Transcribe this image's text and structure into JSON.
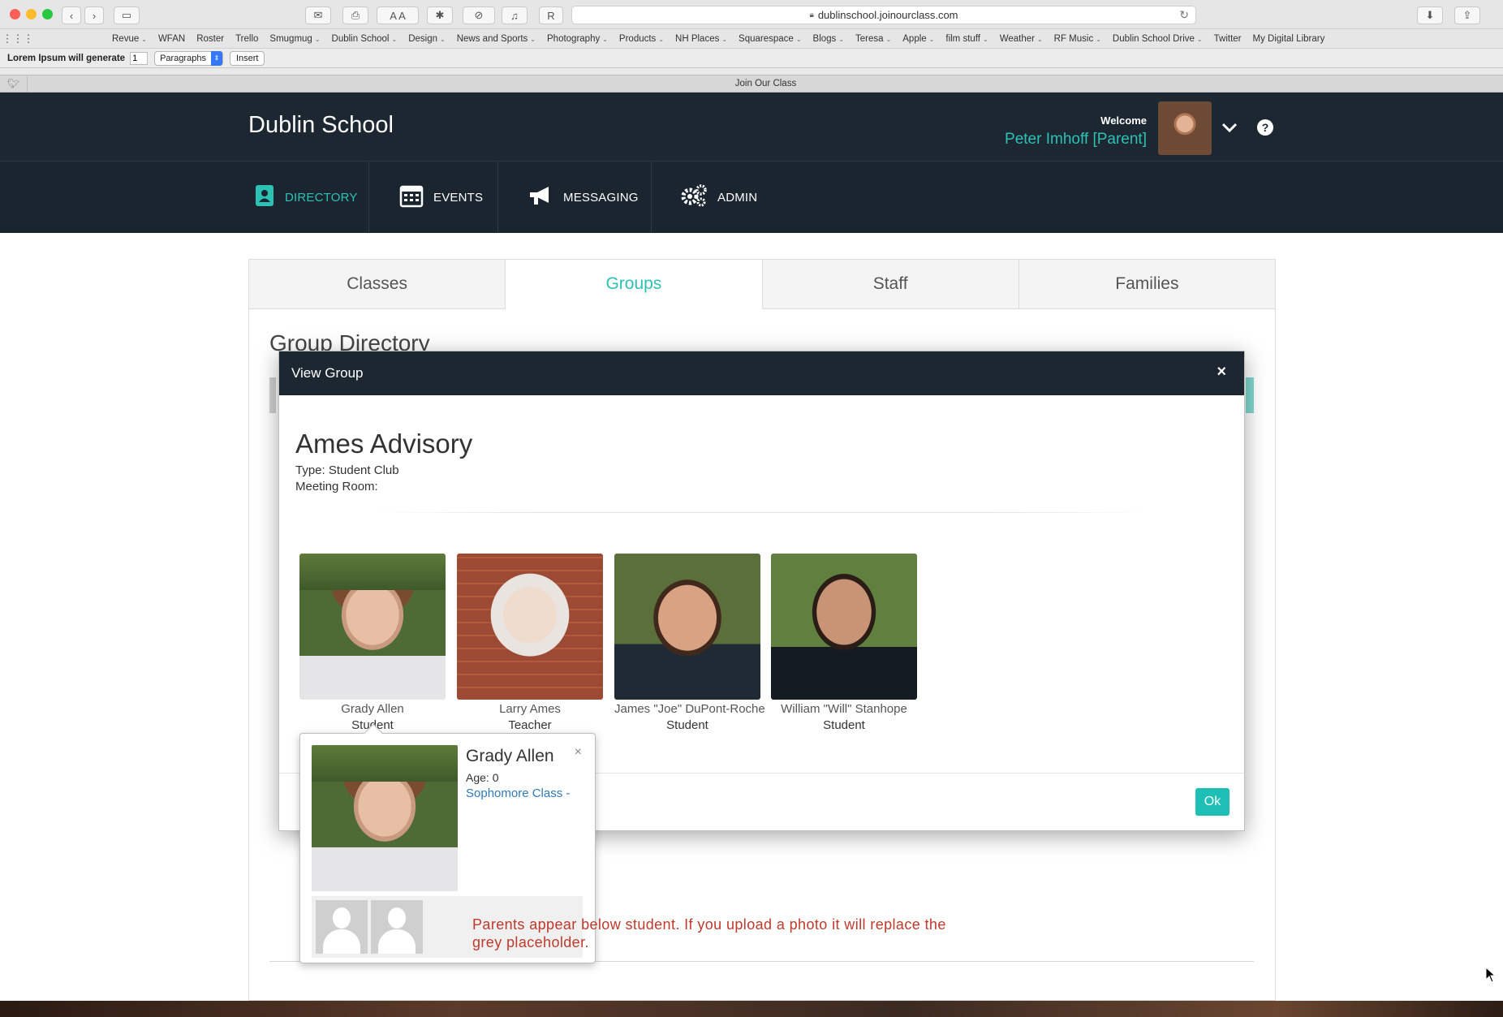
{
  "browser": {
    "url": "dublinschool.joinourclass.com",
    "tab_title": "Join Our Class",
    "bookmarks": [
      {
        "label": "Revue",
        "dropdown": true
      },
      {
        "label": "WFAN",
        "dropdown": false
      },
      {
        "label": "Roster",
        "dropdown": false
      },
      {
        "label": "Trello",
        "dropdown": false
      },
      {
        "label": "Smugmug",
        "dropdown": true
      },
      {
        "label": "Dublin School",
        "dropdown": true
      },
      {
        "label": "Design",
        "dropdown": true
      },
      {
        "label": "News and Sports",
        "dropdown": true
      },
      {
        "label": "Photography",
        "dropdown": true
      },
      {
        "label": "Products",
        "dropdown": true
      },
      {
        "label": "NH Places",
        "dropdown": true
      },
      {
        "label": "Squarespace",
        "dropdown": true
      },
      {
        "label": "Blogs",
        "dropdown": true
      },
      {
        "label": "Teresa",
        "dropdown": true
      },
      {
        "label": "Apple",
        "dropdown": true
      },
      {
        "label": "film stuff",
        "dropdown": true
      },
      {
        "label": "Weather",
        "dropdown": true
      },
      {
        "label": "RF Music",
        "dropdown": true
      },
      {
        "label": "Dublin School Drive",
        "dropdown": true
      },
      {
        "label": "Twitter",
        "dropdown": false
      },
      {
        "label": "My Digital Library",
        "dropdown": false
      }
    ]
  },
  "lorem_bar": {
    "label": "Lorem Ipsum will generate",
    "count": "1",
    "type": "Paragraphs",
    "insert": "Insert"
  },
  "header": {
    "brand": "Dublin School",
    "welcome": "Welcome",
    "user": "Peter Imhoff [Parent]"
  },
  "nav": {
    "directory": "DIRECTORY",
    "events": "EVENTS",
    "messaging": "MESSAGING",
    "admin": "ADMIN"
  },
  "dir_tabs": {
    "classes": "Classes",
    "groups": "Groups",
    "staff": "Staff",
    "families": "Families"
  },
  "page": {
    "title": "Group Directory"
  },
  "modal": {
    "title": "View Group",
    "close": "×",
    "group_name": "Ames Advisory",
    "type_line": "Type: Student Club",
    "room_line": "Meeting Room:",
    "members": [
      {
        "name": "Grady Allen",
        "role": "Student"
      },
      {
        "name": "Larry Ames",
        "role": "Teacher"
      },
      {
        "name": "James \"Joe\" DuPont-Roche",
        "role": "Student"
      },
      {
        "name": "William \"Will\" Stanhope",
        "role": "Student"
      }
    ],
    "ok": "Ok"
  },
  "popover": {
    "name": "Grady Allen",
    "age": "Age: 0",
    "class_link": "Sophomore Class -",
    "close": "×"
  },
  "annotation": "Parents appear below student. If you upload a photo it will replace the grey placeholder.",
  "colors": {
    "teal": "#2cc1b5",
    "header_bg": "#1d2731",
    "annotation_red": "#c0392b"
  }
}
